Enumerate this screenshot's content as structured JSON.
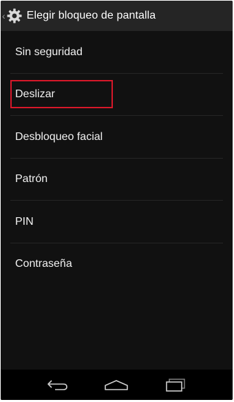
{
  "action_bar": {
    "title": "Elegir bloqueo de pantalla",
    "up_icon": "chevron-left-icon",
    "app_icon": "gear-icon"
  },
  "options": [
    {
      "label": "Sin seguridad"
    },
    {
      "label": "Deslizar",
      "highlighted": true
    },
    {
      "label": "Desbloqueo facial"
    },
    {
      "label": "Patrón"
    },
    {
      "label": "PIN"
    },
    {
      "label": "Contraseña"
    }
  ],
  "nav_bar": {
    "back_icon": "back-arrow-icon",
    "home_icon": "home-icon",
    "recents_icon": "recent-apps-icon"
  },
  "colors": {
    "highlight": "#d8182a",
    "action_bar": "#252525",
    "list_background": "#111111"
  }
}
